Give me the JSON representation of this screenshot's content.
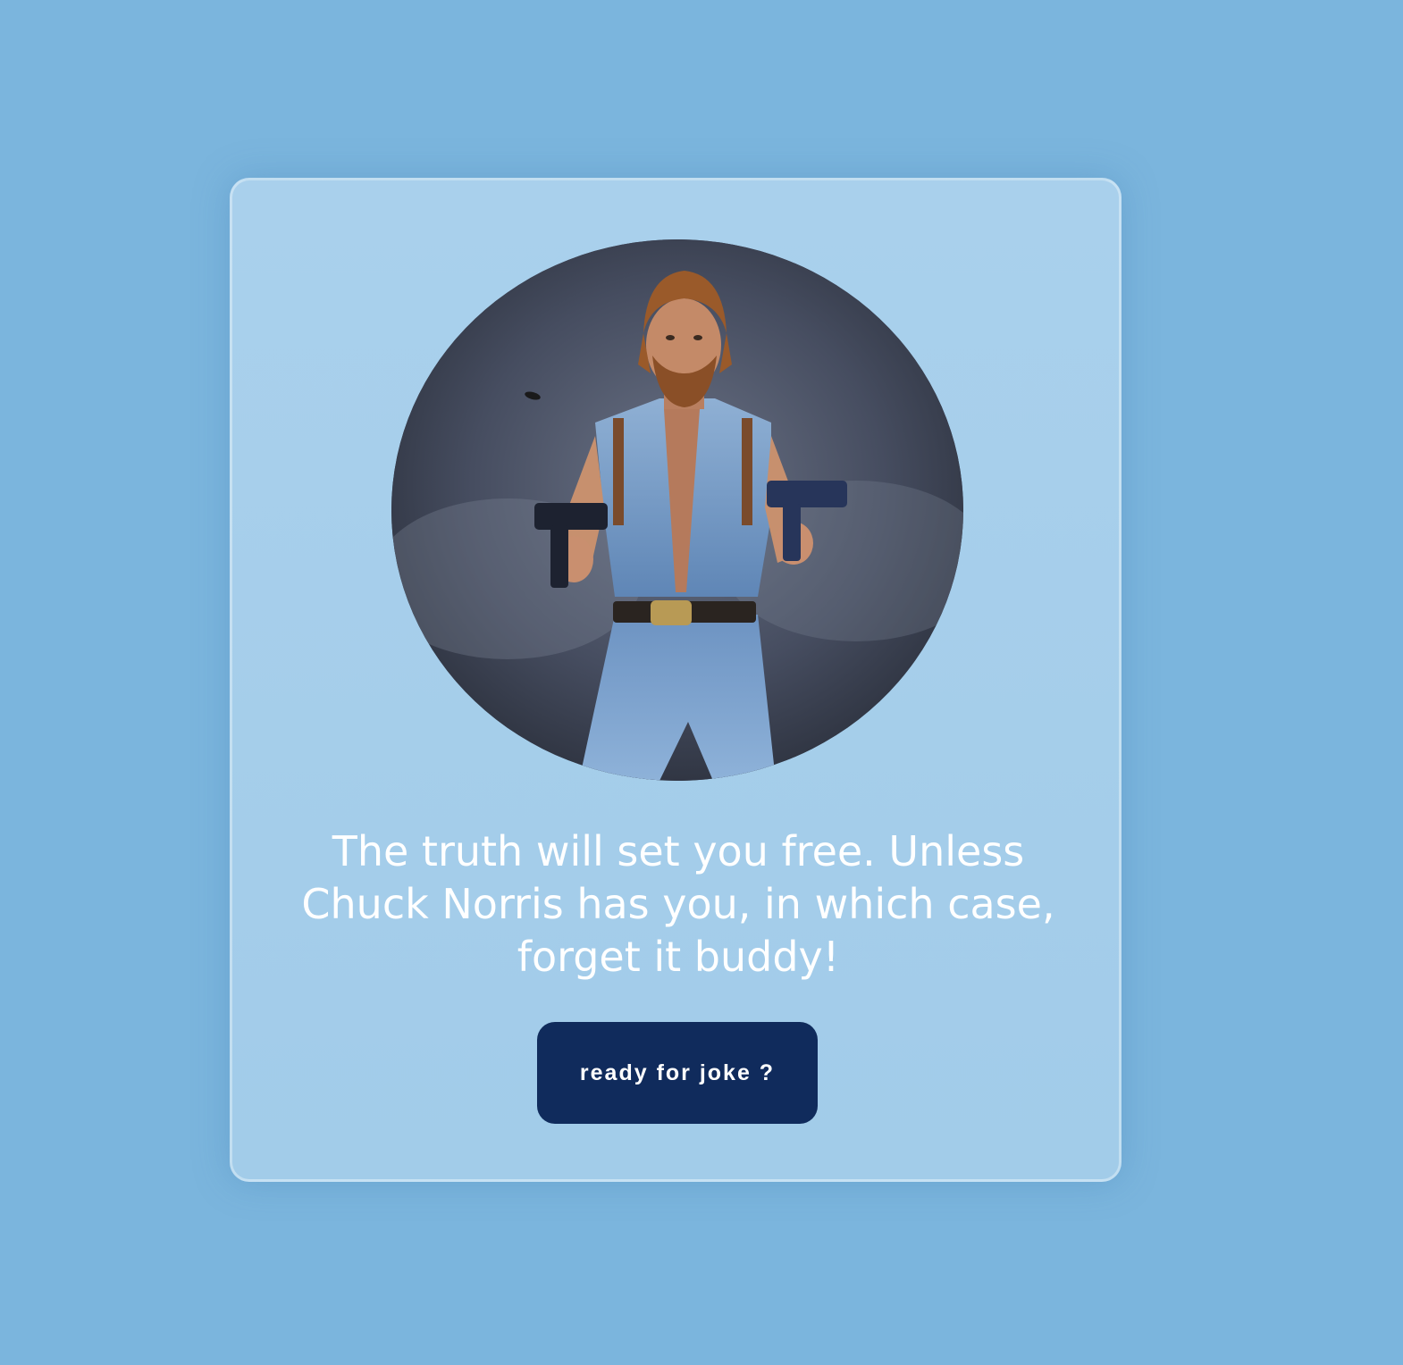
{
  "joke_card": {
    "portrait": {
      "subject": "man in sleeveless denim shirt holding two pistols"
    },
    "joke_text": "The truth will set you free. Unless Chuck Norris has you, in which case, forget it buddy!",
    "button_label": "ready for joke ?"
  },
  "colors": {
    "page_background": "#7bb5dd",
    "card_background": "#a6cfea",
    "button_background": "#102b5c",
    "text": "#ffffff"
  }
}
